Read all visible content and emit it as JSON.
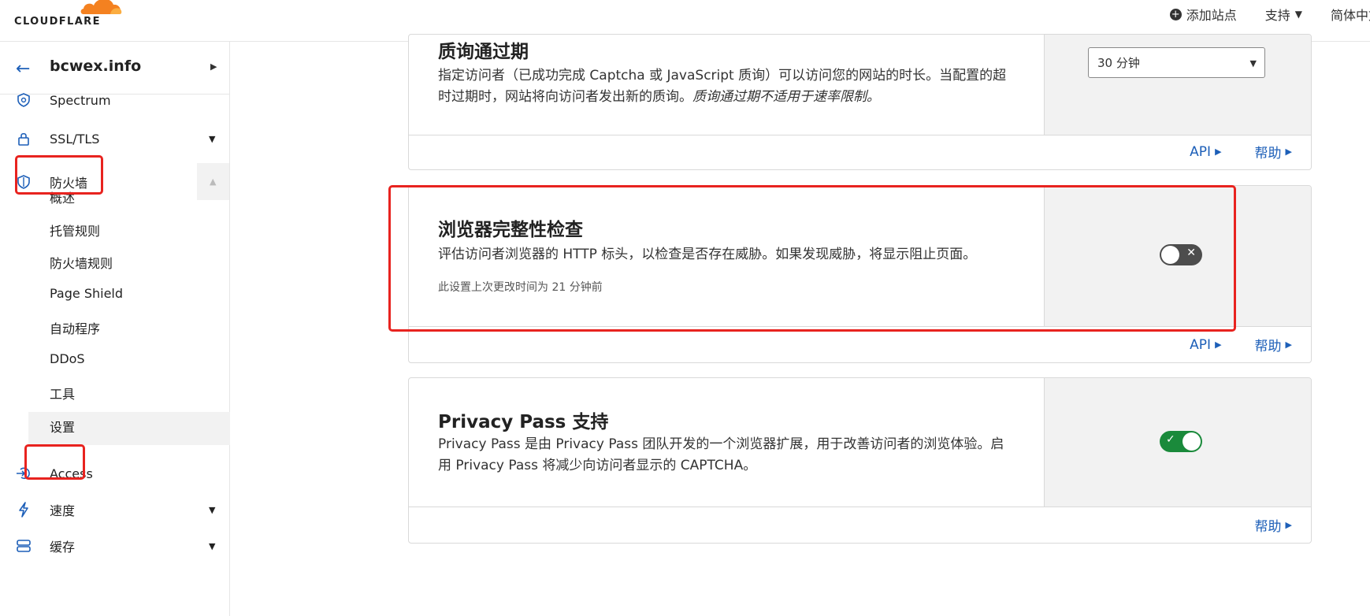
{
  "header": {
    "logo_text": "CLOUDFLARE",
    "add_site": "添加站点",
    "support": "支持",
    "language": "简体中文",
    "brand_color": "#f48120"
  },
  "sidebar": {
    "site_name": "bcwex.info",
    "items": [
      {
        "label": "Spectrum",
        "icon": "shield-gear-icon"
      },
      {
        "label": "SSL/TLS",
        "icon": "lock-icon"
      },
      {
        "label": "防火墙",
        "icon": "shield-icon"
      },
      {
        "label": "Access",
        "icon": "access-arrow-icon"
      },
      {
        "label": "速度",
        "icon": "lightning-icon"
      },
      {
        "label": "缓存",
        "icon": "storage-icon"
      }
    ],
    "firewall_sub": [
      "概述",
      "托管规则",
      "防火墙规则",
      "Page Shield",
      "自动程序",
      "DDoS",
      "工具",
      "设置"
    ]
  },
  "cards": {
    "challenge": {
      "title": "质询通过期",
      "desc": "指定访问者（已成功完成 Captcha 或 JavaScript 质询）可以访问您的网站的时长。当配置的超时过期时，网站将向访问者发出新的质询。",
      "desc_italic": "质询通过期不适用于速率限制。",
      "select_value": "30 分钟",
      "api": "API",
      "help": "帮助"
    },
    "browser_check": {
      "title": "浏览器完整性检查",
      "desc": "评估访问者浏览器的 HTTP 标头，以检查是否存在威胁。如果发现威胁，将显示阻止页面。",
      "meta": "此设置上次更改时间为 21 分钟前",
      "toggle": "off",
      "api": "API",
      "help": "帮助"
    },
    "privacy_pass": {
      "title": "Privacy Pass 支持",
      "desc": "Privacy Pass 是由 Privacy Pass 团队开发的一个浏览器扩展，用于改善访问者的浏览体验。启用 Privacy Pass 将减少向访问者显示的 CAPTCHA。",
      "toggle": "on",
      "help": "帮助"
    }
  },
  "colors": {
    "link": "#1d5fb8",
    "highlight": "#e8231f",
    "toggle_on": "#1a8a3b",
    "toggle_off": "#4d4d4d"
  }
}
